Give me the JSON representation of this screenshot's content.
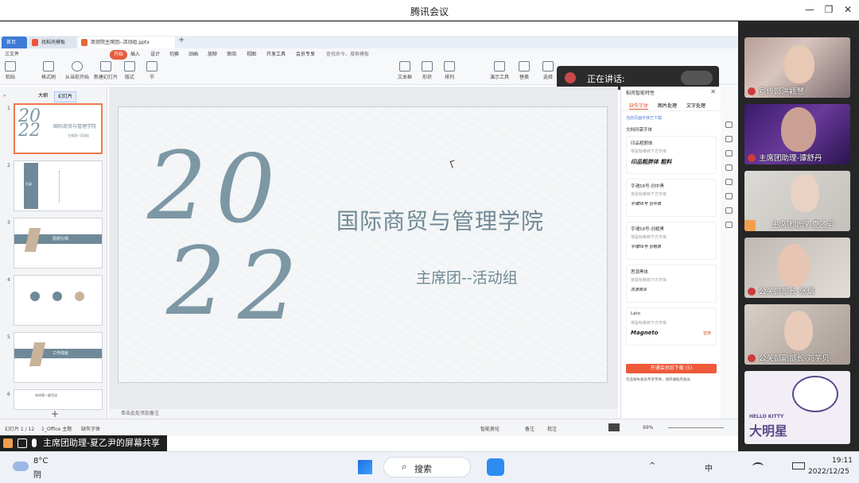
{
  "window": {
    "title": "腾讯会议"
  },
  "wps": {
    "tabs": [
      {
        "label": "首页"
      },
      {
        "label": "找稻壳模板"
      },
      {
        "label": "商贸院主席团--活动组.pptx"
      }
    ],
    "menu": [
      "三文件",
      "开始",
      "插入",
      "设计",
      "切换",
      "动画",
      "放映",
      "审阅",
      "视图",
      "开发工具",
      "会员专享"
    ],
    "search_label": "查找命令、搜索模板",
    "ribbon_buttons": [
      "粘贴",
      "格式刷",
      "从当前开始",
      "新建幻灯片",
      "版式",
      "节",
      "文本框",
      "形状",
      "排列",
      "演示工具",
      "替换",
      "选择"
    ],
    "panel_tabs": [
      "大纲",
      "幻灯片"
    ],
    "slide_numbers": [
      "1",
      "2",
      "3",
      "4",
      "5",
      "6"
    ],
    "thumb_texts": {
      "t1": "国际商贸与管理学院",
      "t1b": "主席团--活动组",
      "t3": "思想引领",
      "t5": "工作成就",
      "t6": "年终第一星活动",
      "t2": "目录"
    }
  },
  "speaking": {
    "label": "正在讲话:"
  },
  "slide": {
    "digit1": "2",
    "digit2": "0",
    "digit3": "2",
    "digit4": "2",
    "title": "国际商贸与管理学院",
    "subtitle": "主席团--活动组"
  },
  "notes": {
    "label": "单击此处添加备注"
  },
  "right_panel": {
    "title": "稻壳智能特性",
    "tabs": [
      "缺失字体",
      "图片处理",
      "文字处理"
    ],
    "notice": "当前页面字体已下载",
    "section": "文档所需字体",
    "fonts": [
      {
        "name": "印品粗朗体",
        "hint": "将鼠标移到下方字体",
        "preview": "印品粗胖体 粗料",
        "tag": ""
      },
      {
        "name": "字魂58号-创中黑",
        "hint": "将鼠标移到下方字体",
        "preview": "字魂58号 创中黑",
        "tag": ""
      },
      {
        "name": "字魂59号-创粗黑",
        "hint": "将鼠标移到下方字体",
        "preview": "字魂59号 创粗黑",
        "tag": ""
      },
      {
        "name": "思源黑体",
        "hint": "将鼠标移到下方字体",
        "preview": "思源黑体",
        "tag": ""
      },
      {
        "name": "Lato",
        "hint": "将鼠标移到下方字体",
        "preview": "Magneto",
        "tag": "替换"
      }
    ],
    "download_button": "开通会员后下载 (5)",
    "footer": "包含缺失会员专享字体，请开通稻壳会员"
  },
  "statusbar": {
    "slide": "幻灯片 1 / 12",
    "theme": "1_Office 主题",
    "missing_font": "缺失字体",
    "beautify": "智能美化",
    "remarks": "备注",
    "comment": "批注",
    "zoom": "99%"
  },
  "sharebar": {
    "label": "主席团助理-夏乙尹的屏幕共享"
  },
  "participants": [
    {
      "name": "宣传部洪颖慧"
    },
    {
      "name": "主席团助理-谭舒丹"
    },
    {
      "name": "主席团助理-夏乙尹"
    },
    {
      "name": "公关部部长-张烟"
    },
    {
      "name": "公关部副部长-刘芋贝"
    }
  ],
  "weather": {
    "temp": "8°C",
    "cond": "阴"
  },
  "taskbar": {
    "search": "搜索",
    "time": "19:11",
    "date": "2022/12/25",
    "ime": "中"
  },
  "brand": {
    "hello_kitty": "HELLO KITTY",
    "big_star": "大明星"
  },
  "colors": {
    "accent": "#ee5a3a",
    "slide_text": "#6f8995"
  }
}
